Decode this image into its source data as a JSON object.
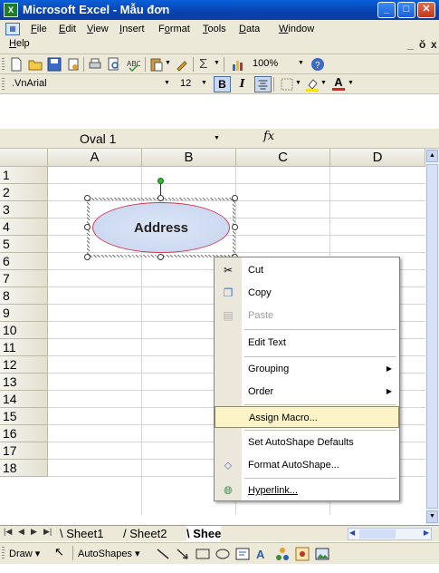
{
  "window": {
    "title": "Microsoft Excel - Mẫu đơn",
    "app_icon": "excel-icon",
    "buttons": [
      "minimize",
      "maximize",
      "close"
    ]
  },
  "menubar": {
    "items": [
      {
        "label": "File",
        "ul": "F",
        "rest": "ile"
      },
      {
        "label": "Edit",
        "ul": "E",
        "rest": "dit"
      },
      {
        "label": "View",
        "ul": "V",
        "rest": "iew"
      },
      {
        "label": "Insert",
        "ul": "I",
        "rest": "nsert"
      },
      {
        "label": "Format",
        "ul": "o",
        "rest": ""
      },
      {
        "label": "Tools",
        "ul": "T",
        "rest": "ools"
      },
      {
        "label": "Data",
        "ul": "D",
        "rest": "ata"
      },
      {
        "label": "Window",
        "ul": "W",
        "rest": "indow"
      },
      {
        "label": "Help",
        "ul": "H",
        "rest": "elp"
      }
    ]
  },
  "standard_toolbar": {
    "zoom": "100%",
    "sigma": "Σ"
  },
  "format_toolbar": {
    "font": ".VnArial",
    "size": "12",
    "bold": "B",
    "italic": "I"
  },
  "formula_bar": {
    "name_box": "Oval 1",
    "fx": "fx",
    "value": ""
  },
  "grid": {
    "columns": [
      "A",
      "B",
      "C",
      "D"
    ],
    "rows": [
      "1",
      "2",
      "3",
      "4",
      "5",
      "6",
      "7",
      "8",
      "9",
      "10",
      "11",
      "12",
      "13",
      "14",
      "15",
      "16",
      "17",
      "18"
    ]
  },
  "shape": {
    "text": "Address",
    "fill": "#cfdaf1",
    "border_color": "#d23a52"
  },
  "context_menu": {
    "items": [
      {
        "label": "Cut",
        "ul_index": 2,
        "icon": "scissors-icon",
        "enabled": true
      },
      {
        "label": "Copy",
        "ul_index": 0,
        "icon": "copy-icon",
        "enabled": true
      },
      {
        "label": "Paste",
        "ul_index": 0,
        "icon": "paste-icon",
        "enabled": false
      },
      {
        "label": "Edit Text",
        "ul_index": 7,
        "icon": "",
        "enabled": true
      },
      {
        "label": "Grouping",
        "ul_index": 0,
        "icon": "",
        "enabled": true,
        "submenu": true
      },
      {
        "label": "Order",
        "ul_index": 1,
        "icon": "",
        "enabled": true,
        "submenu": true
      },
      {
        "label": "Assign Macro...",
        "ul_index": 10,
        "icon": "",
        "enabled": true,
        "highlighted": true
      },
      {
        "label": "Set AutoShape Defaults",
        "ul_index": 15,
        "icon": "",
        "enabled": true
      },
      {
        "label": "Format AutoShape...",
        "ul_index": 10,
        "icon": "format-shape-icon",
        "enabled": true
      },
      {
        "label": "Hyperlink...",
        "ul_index": 0,
        "icon": "hyperlink-icon",
        "enabled": true
      }
    ],
    "highlight_color": "#fcf3c6"
  },
  "sheets": {
    "tabs": [
      "Sheet1",
      "Sheet2",
      "Shee"
    ],
    "active": "Shee"
  },
  "drawing_toolbar": {
    "draw": "Draw",
    "autoshapes": "AutoShapes"
  }
}
